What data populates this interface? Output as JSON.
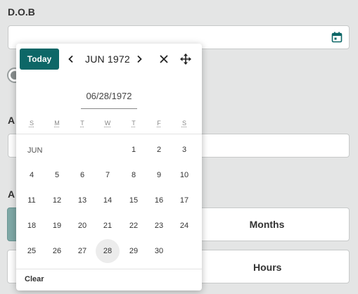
{
  "form": {
    "dob_label": "D.O.B",
    "label_a": "A",
    "label_b": "A",
    "age_unit_options": [
      "Months"
    ],
    "time_unit_options": [
      "Hours"
    ]
  },
  "datepicker": {
    "today_label": "Today",
    "month_year": "JUN 1972",
    "input_value": "06/28/1972",
    "weekdays": [
      "S",
      "M",
      "T",
      "W",
      "T",
      "F",
      "S"
    ],
    "month_short": "JUN",
    "first_weekday_index": 4,
    "days_in_month": 30,
    "selected_day": 28,
    "clear_label": "Clear"
  },
  "icons": {
    "calendar": "calendar-icon",
    "prev": "chevron-left-icon",
    "next": "chevron-right-icon",
    "close": "close-icon",
    "move": "move-icon"
  },
  "colors": {
    "accent": "#0d6767",
    "selected_segment": "#7fa8a6",
    "background": "#e4e5e5"
  }
}
